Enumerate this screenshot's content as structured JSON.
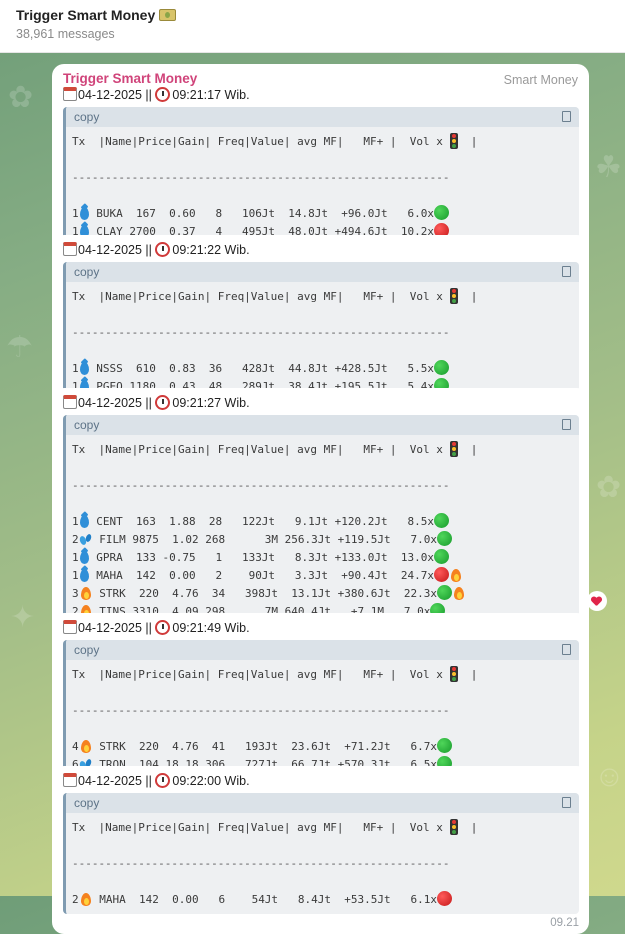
{
  "header": {
    "title": "Trigger Smart Money",
    "title_icon": "money-icon",
    "subtitle": "38,961 messages"
  },
  "table_header": "Tx  |Name|Price|Gain| Freq|Value| avg MF|   MF+ |  Vol x",
  "table_separator": "---------------------------------------------------------",
  "code_label": "copy",
  "messages": [
    {
      "sender": "Trigger Smart Money",
      "sender_tag": "Smart Money",
      "date": "04-12-2025",
      "time_text": "09:21:17 Wib.",
      "sent": "09.21",
      "rows": [
        {
          "tx": "1",
          "icon": "drop",
          "text": " BUKA  167  0.60   8   106Jt  14.8Jt  +96.0Jt   6.0x",
          "signal": [
            "green"
          ]
        },
        {
          "tx": "1",
          "icon": "drop",
          "text": " CLAY 2700  0.37   4   495Jt  48.0Jt +494.6Jt  10.2x",
          "signal": [
            "red"
          ]
        }
      ]
    },
    {
      "date": "04-12-2025",
      "time_text": "09:21:22 Wib.",
      "sent": "09.21",
      "rows": [
        {
          "tx": "1",
          "icon": "drop",
          "text": " NSSS  610  0.83  36   428Jt  44.8Jt +428.5Jt   5.5x",
          "signal": [
            "green"
          ]
        },
        {
          "tx": "1",
          "icon": "drop",
          "text": " PGEO 1180  0.43  48   289Jt  38.4Jt +195.5Jt   5.4x",
          "signal": [
            "green"
          ]
        }
      ]
    },
    {
      "date": "04-12-2025",
      "time_text": "09:21:27 Wib.",
      "sent": "09.21",
      "reaction": "heart",
      "rows": [
        {
          "tx": "1",
          "icon": "drop",
          "text": " CENT  163  1.88  28   122Jt   9.1Jt +120.2Jt   8.5x",
          "signal": [
            "green"
          ]
        },
        {
          "tx": "2",
          "icon": "splash",
          "text": " FILM 9875  1.02 268      3M 256.3Jt +119.5Jt   7.0x",
          "signal": [
            "green"
          ]
        },
        {
          "tx": "1",
          "icon": "drop",
          "text": " GPRA  133 -0.75   1   133Jt   8.3Jt +133.0Jt  13.0x",
          "signal": [
            "green"
          ]
        },
        {
          "tx": "1",
          "icon": "drop",
          "text": " MAHA  142  0.00   2    90Jt   3.3Jt  +90.4Jt  24.7x",
          "signal": [
            "red",
            "fire"
          ]
        },
        {
          "tx": "3",
          "icon": "fire",
          "text": " STRK  220  4.76  34   398Jt  13.1Jt +380.6Jt  22.3x",
          "signal": [
            "green",
            "fire"
          ]
        },
        {
          "tx": "2",
          "icon": "fire",
          "text": " TINS 3310  4.09 298      7M 640.4Jt   +7.1M   7.0x",
          "signal": [
            "green"
          ]
        }
      ]
    },
    {
      "date": "04-12-2025",
      "time_text": "09:21:49 Wib.",
      "sent": "09.21",
      "rows": [
        {
          "tx": "4",
          "icon": "fire",
          "text": " STRK  220  4.76  41   193Jt  23.6Jt  +71.2Jt   6.7x",
          "signal": [
            "green"
          ]
        },
        {
          "tx": "6",
          "icon": "splash",
          "text": " TRON  104 18.18 306   727Jt  66.7Jt +570.3Jt   6.5x",
          "signal": [
            "green"
          ]
        }
      ]
    },
    {
      "date": "04-12-2025",
      "time_text": "09:22:00 Wib.",
      "sent": "09.21",
      "rows": [
        {
          "tx": "2",
          "icon": "fire",
          "text": " MAHA  142  0.00   6    54Jt   8.4Jt  +53.5Jt   6.1x",
          "signal": [
            "red"
          ]
        }
      ]
    }
  ]
}
